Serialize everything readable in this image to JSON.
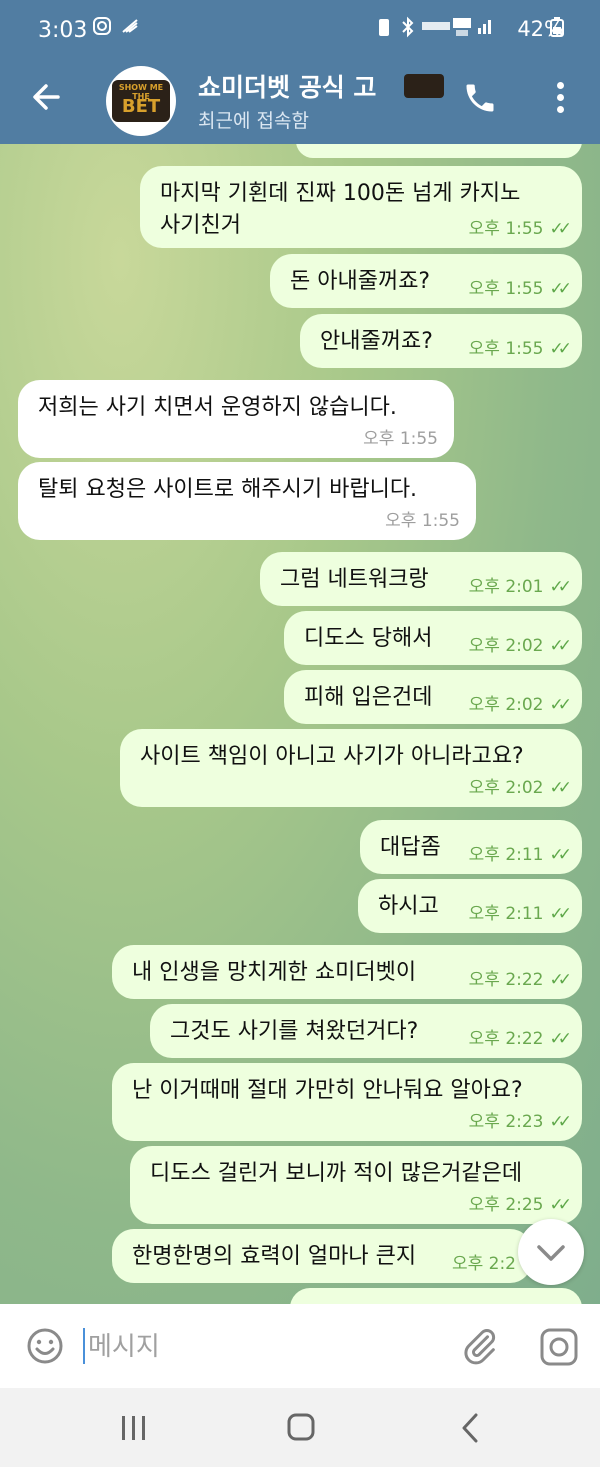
{
  "status": {
    "time": "3:03",
    "right_text": "42%"
  },
  "header": {
    "title": "쇼미더벳 공식 고",
    "subtitle": "최근에 접속함",
    "avatar_logo_top": "SHOW ME THE",
    "avatar_logo_bottom": "BET"
  },
  "messages": [
    {
      "dir": "out",
      "text": "마지막 기횐데 진짜 100돈 넘게 카지노",
      "text2": "사기친거",
      "time": "오후 1:55"
    },
    {
      "dir": "out",
      "text": "돈 아내줄꺼죠?",
      "time": "오후 1:55"
    },
    {
      "dir": "out",
      "text": "안내줄꺼죠?",
      "time": "오후 1:55"
    },
    {
      "dir": "in",
      "text": "저희는 사기 치면서 운영하지 않습니다.",
      "time": "오후 1:55"
    },
    {
      "dir": "in",
      "text": "탈퇴 요청은 사이트로 해주시기 바랍니다.",
      "time": "오후 1:55"
    },
    {
      "dir": "out",
      "text": "그럼 네트워크랑",
      "time": "오후 2:01"
    },
    {
      "dir": "out",
      "text": "디도스 당해서",
      "time": "오후 2:02"
    },
    {
      "dir": "out",
      "text": "피해 입은건데",
      "time": "오후 2:02"
    },
    {
      "dir": "out",
      "text": "사이트 책임이 아니고 사기가 아니라고요?",
      "time": "오후 2:02"
    },
    {
      "dir": "out",
      "text": "대답좀",
      "time": "오후 2:11"
    },
    {
      "dir": "out",
      "text": "하시고",
      "time": "오후 2:11"
    },
    {
      "dir": "out",
      "text": "내 인생을 망치게한 쇼미더벳이",
      "time": "오후 2:22"
    },
    {
      "dir": "out",
      "text": "그것도 사기를 쳐왔던거다?",
      "time": "오후 2:22"
    },
    {
      "dir": "out",
      "text": "난 이거때매 절대 가만히 안나둬요 알아요?",
      "time": "오후 2:23"
    },
    {
      "dir": "out",
      "text": "디도스 걸린거 보니까 적이 많은거같은데",
      "time": "오후 2:25"
    },
    {
      "dir": "out",
      "text": "한명한명의 효력이 얼마나 큰지",
      "time": "오후 2:2"
    }
  ],
  "input": {
    "placeholder": "메시지"
  },
  "icons": {
    "back": "arrow-left-icon",
    "call": "phone-icon",
    "menu": "more-vert-icon",
    "emoji": "smiley-icon",
    "attach": "paperclip-icon",
    "camera": "camera-icon",
    "scroll": "chevron-down-icon"
  },
  "colors": {
    "header": "#517da2",
    "outgoing_bubble": "#eeffde",
    "incoming_bubble": "#ffffff",
    "read_check": "#5fa84a"
  }
}
